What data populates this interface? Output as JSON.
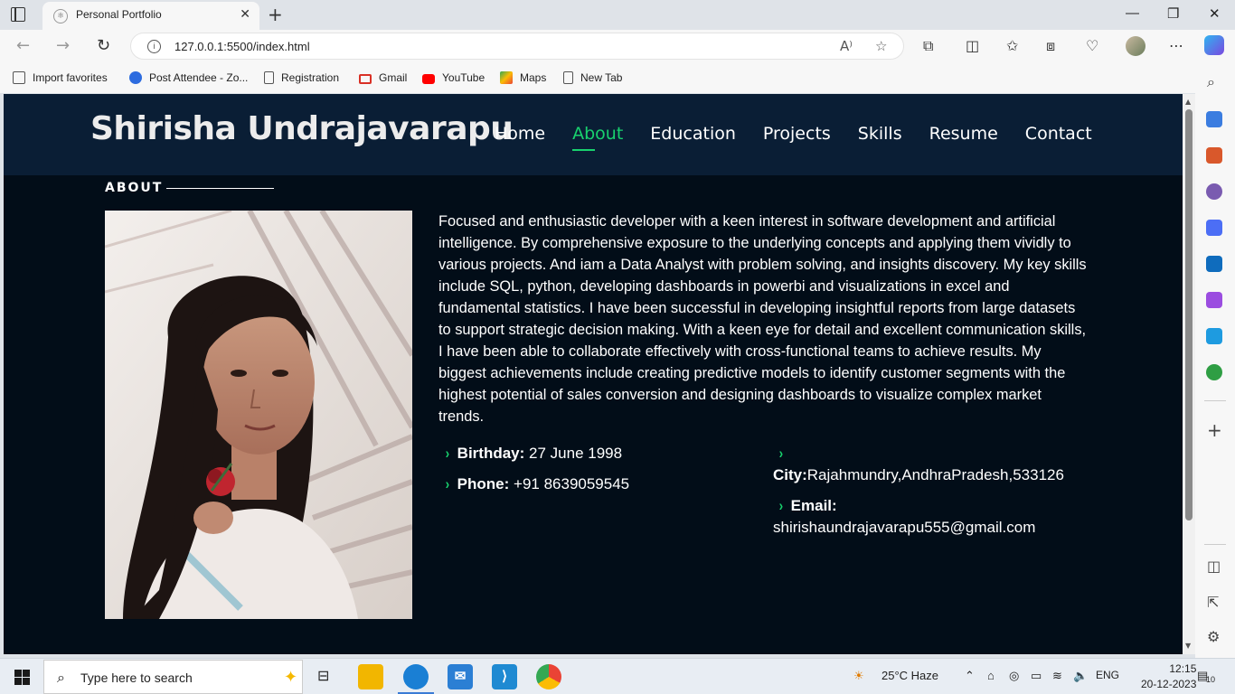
{
  "browser": {
    "tab_title": "Personal Portfolio",
    "url": "127.0.0.1:5500/index.html",
    "favorites": [
      {
        "label": "Import favorites",
        "color": "#555555"
      },
      {
        "label": "Post Attendee - Zo...",
        "color": "#2d6cdf"
      },
      {
        "label": "Registration",
        "color": "#555555"
      },
      {
        "label": "Gmail",
        "color": "#d93025"
      },
      {
        "label": "YouTube",
        "color": "#ff0000"
      },
      {
        "label": "Maps",
        "color": "#34a853"
      },
      {
        "label": "New Tab",
        "color": "#555555"
      }
    ]
  },
  "site": {
    "brand": "Shirisha Undrajavarapu",
    "nav": [
      {
        "label": "Home",
        "active": false
      },
      {
        "label": "About",
        "active": true
      },
      {
        "label": "Education",
        "active": false
      },
      {
        "label": "Projects",
        "active": false
      },
      {
        "label": "Skills",
        "active": false
      },
      {
        "label": "Resume",
        "active": false
      },
      {
        "label": "Contact",
        "active": false
      }
    ],
    "accent_color": "#18d26e"
  },
  "about": {
    "section_title": "ABOUT",
    "bio": "Focused and enthusiastic developer with a keen interest in software development and artificial intelligence. By comprehensive exposure to the underlying concepts and applying them vividly to various projects. And iam a Data Analyst with problem solving, and insights discovery. My key skills include SQL, python, developing dashboards in powerbi and visualizations in excel and fundamental statistics. I have been successful in developing insightful reports from large datasets to support strategic decision making. With a keen eye for detail and excellent communication skills, I have been able to collaborate effectively with cross-functional teams to achieve results. My biggest achievements include creating predictive models to identify customer segments with the highest potential of sales conversion and designing dashboards to visualize complex market trends.",
    "birthday_label": "Birthday:",
    "birthday_value": "27 June 1998",
    "phone_label": "Phone:",
    "phone_value": "+91 8639059545",
    "city_label": "City:",
    "city_value": "Rajahmundry,AndhraPradesh,533126",
    "email_label": "Email:",
    "email_value": "shirishaundrajavarapu555@gmail.com"
  },
  "taskbar": {
    "search_placeholder": "Type here to search",
    "weather": "25°C  Haze",
    "language": "ENG",
    "time": "12:15",
    "date": "20-12-2023",
    "notifications": "10"
  }
}
